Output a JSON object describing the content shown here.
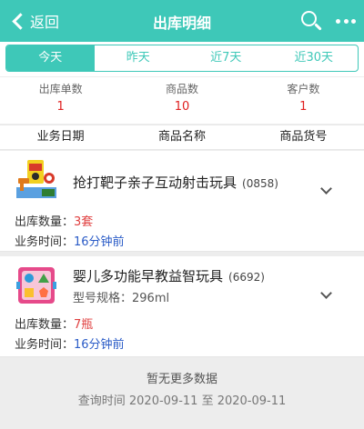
{
  "header": {
    "back_label": "返回",
    "title": "出库明细"
  },
  "tabs": [
    {
      "label": "今天",
      "active": true
    },
    {
      "label": "昨天",
      "active": false
    },
    {
      "label": "近7天",
      "active": false
    },
    {
      "label": "近30天",
      "active": false
    }
  ],
  "stats": [
    {
      "label": "出库单数",
      "value": "1"
    },
    {
      "label": "商品数",
      "value": "10"
    },
    {
      "label": "客户数",
      "value": "1"
    }
  ],
  "columns": [
    "业务日期",
    "商品名称",
    "商品货号"
  ],
  "items": [
    {
      "name": "抢打靶子亲子互动射击玩具",
      "code": "(0858)",
      "qty_label": "出库数量：",
      "qty_value": "3套",
      "time_label": "业务时间：",
      "time_value": "16分钟前",
      "thumb_icon": "toy-gun-target-icon"
    },
    {
      "name": "婴儿多功能早教益智玩具",
      "code": "(6692)",
      "spec": "型号规格：296ml",
      "qty_label": "出库数量：",
      "qty_value": "7瓶",
      "time_label": "业务时间：",
      "time_value": "16分钟前",
      "thumb_icon": "shape-sorter-toy-icon"
    }
  ],
  "footer": {
    "no_more": "暂无更多数据",
    "query": "查询时间 2020-09-11 至 2020-09-11"
  },
  "colors": {
    "accent": "#3ec8b8",
    "value_red": "#e02020",
    "qty_red": "#e04040",
    "time_blue": "#2b5cc7"
  }
}
